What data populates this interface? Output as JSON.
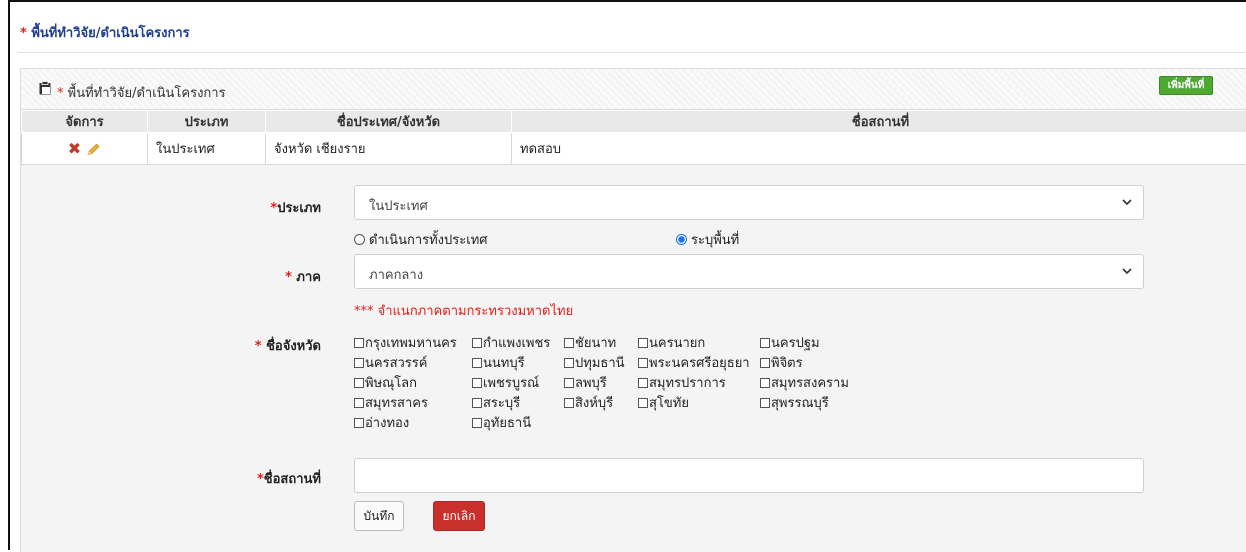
{
  "section": {
    "star": "* ",
    "title": "พื้นที่ทำวิจัย/ดำเนินโครงการ"
  },
  "panel": {
    "icon": "clipboard-icon",
    "star": "* ",
    "title": "พื้นที่ทำวิจัย/ดำเนินโครงการ",
    "add_button": "เพิ่มพื้นที่"
  },
  "table": {
    "headers": [
      "จัดการ",
      "ประเภท",
      "ชื่อประเทศ/จังหวัด",
      "ชื่อสถานที่"
    ],
    "rows": [
      {
        "type": "ในประเทศ",
        "province": "จังหวัด เชียงราย",
        "place": "ทดสอบ"
      }
    ]
  },
  "form": {
    "type_label_star": "*",
    "type_label": "ประเภท",
    "type_value": "ในประเทศ",
    "radio_whole_country": "ดำเนินการทั้งประเทศ",
    "radio_specify_area": "ระบุพื้นที่",
    "region_label_star": "* ",
    "region_label": "ภาค",
    "region_value": "ภาคกลาง",
    "region_note": "*** จำแนกภาคตามกระทรวงมหาดไทย",
    "province_label_star": "* ",
    "province_label": "ชื่อจังหวัด",
    "provinces": [
      "กรุงเทพมหานคร",
      "กำแพงเพชร",
      "ชัยนาท",
      "นครนายก",
      "นครปฐม",
      "นครสวรรค์",
      "นนทบุรี",
      "ปทุมธานี",
      "พระนครศรีอยุธยา",
      "พิจิตร",
      "พิษณุโลก",
      "เพชรบูรณ์",
      "ลพบุรี",
      "สมุทรปราการ",
      "สมุทรสงคราม",
      "สมุทรสาคร",
      "สระบุรี",
      "สิงห์บุรี",
      "สุโขทัย",
      "สุพรรณบุรี",
      "อ่างทอง",
      "อุทัยธานี"
    ],
    "place_label_star": "*",
    "place_label": "ชื่อสถานที่",
    "place_value": "",
    "save_button": "บันทึก",
    "cancel_button": "ยกเลิก"
  },
  "colors": {
    "accent_blue": "#1f3f8f",
    "required_red": "#e0201a",
    "add_green": "#4ea832",
    "cancel_red": "#c9302c"
  }
}
